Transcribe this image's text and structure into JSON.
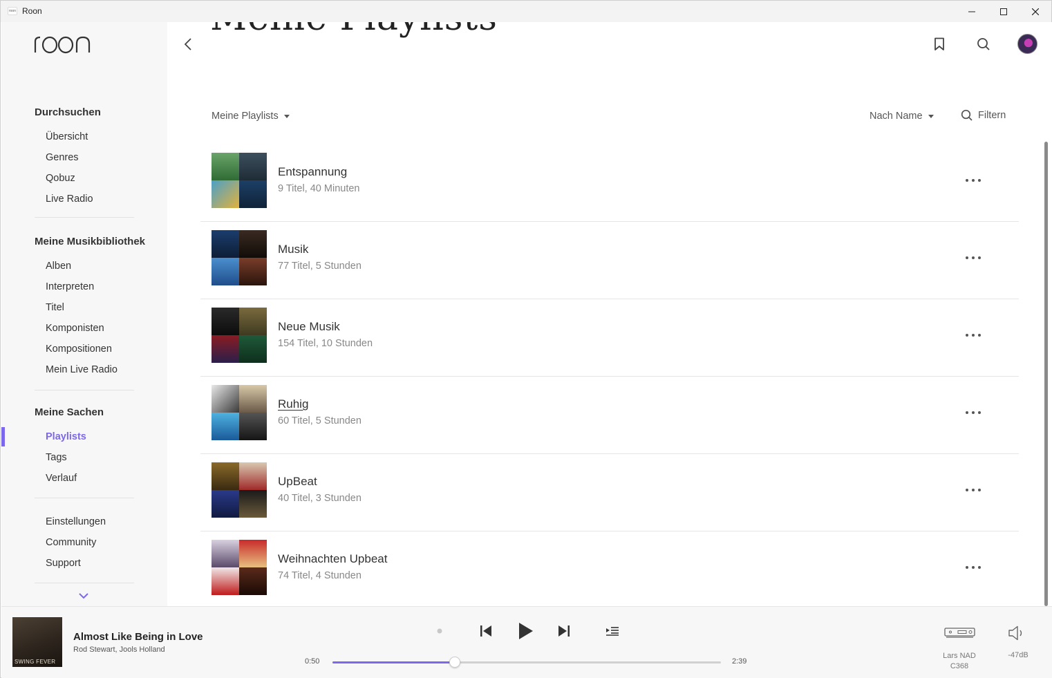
{
  "window": {
    "title": "Roon",
    "app_icon_text": "roon"
  },
  "sidebar": {
    "logo": "roon",
    "sections": [
      {
        "title": "Durchsuchen",
        "items": [
          "Übersicht",
          "Genres",
          "Qobuz",
          "Live Radio"
        ]
      },
      {
        "title": "Meine Musikbibliothek",
        "items": [
          "Alben",
          "Interpreten",
          "Titel",
          "Komponisten",
          "Kompositionen",
          "Mein Live Radio"
        ]
      },
      {
        "title": "Meine Sachen",
        "items": [
          "Playlists",
          "Tags",
          "Verlauf"
        ]
      }
    ],
    "footer_items": [
      "Einstellungen",
      "Community",
      "Support"
    ],
    "active_item": "Playlists",
    "accent_color": "#7b68ee"
  },
  "main": {
    "heading": "Meine Playlists",
    "filter_dropdown": "Meine Playlists",
    "sort_dropdown": "Nach Name",
    "filter_label": "Filtern",
    "playlists": [
      {
        "title": "Entspannung",
        "subtitle": "9 Titel, 40 Minuten"
      },
      {
        "title": "Musik",
        "subtitle": "77 Titel, 5 Stunden"
      },
      {
        "title": "Neue Musik",
        "subtitle": "154 Titel, 10 Stunden"
      },
      {
        "title": "Ruhig",
        "subtitle": "60 Titel, 5 Stunden"
      },
      {
        "title": "UpBeat",
        "subtitle": "40 Titel, 3 Stunden"
      },
      {
        "title": "Weihnachten Upbeat",
        "subtitle": "74 Titel, 4 Stunden"
      }
    ]
  },
  "player": {
    "cover_text": "SWING FEVER",
    "track_title": "Almost Like Being in Love",
    "artist": "Rod Stewart, Jools Holland",
    "elapsed": "0:50",
    "duration": "2:39",
    "progress_fraction": 0.3145,
    "zone_line1": "Lars NAD",
    "zone_line2": "C368",
    "volume": "-47dB"
  }
}
